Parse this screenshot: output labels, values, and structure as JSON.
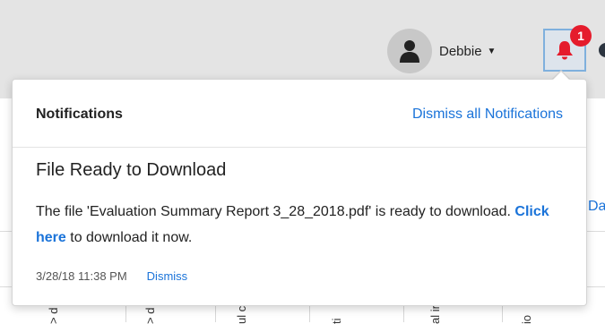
{
  "header": {
    "user_name": "Debbie",
    "notification_count": "1"
  },
  "notifications": {
    "title": "Notifications",
    "dismiss_all_label": "Dismiss all Notifications",
    "items": [
      {
        "title": "File Ready to Download",
        "body_before": "The file 'Evaluation Summary Report 3_28_2018.pdf' is ready to download. ",
        "link_label": "Click here",
        "body_after": " to download it now.",
        "timestamp": "3/28/18 11:38 PM",
        "dismiss_label": "Dismiss"
      }
    ]
  },
  "background": {
    "side_text": "Da",
    "column_glyphs": [
      "> d",
      "> d",
      "ul ck",
      "ti",
      "al ir",
      "io"
    ]
  },
  "colors": {
    "accent": "#1a73d9",
    "badge": "#e51c2c",
    "bell": "#e51c2c"
  },
  "icons": {
    "avatar": "user-silhouette-icon",
    "bell": "bell-icon",
    "caret": "caret-down-icon"
  }
}
